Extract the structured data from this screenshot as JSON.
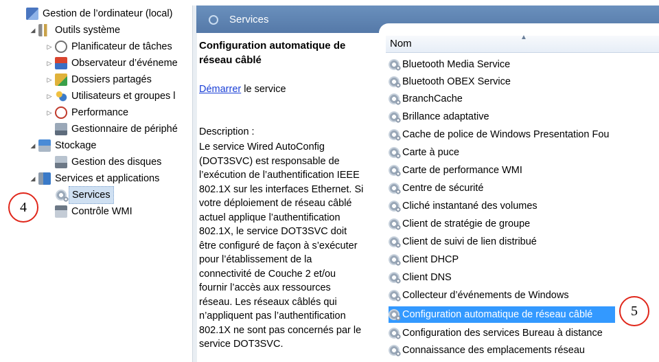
{
  "tree": {
    "root": {
      "label": "Gestion de l’ordinateur (local)",
      "icon": "computer-management-icon"
    },
    "items": [
      {
        "label": "Outils système",
        "icon": "system-tools-icon",
        "expanded": true
      },
      {
        "label": "Planificateur de tâches",
        "icon": "task-scheduler-icon"
      },
      {
        "label": "Observateur d’événeme",
        "icon": "event-viewer-icon"
      },
      {
        "label": "Dossiers partagés",
        "icon": "shared-folders-icon"
      },
      {
        "label": "Utilisateurs et groupes l",
        "icon": "users-groups-icon"
      },
      {
        "label": "Performance",
        "icon": "performance-icon"
      },
      {
        "label": "Gestionnaire de périphé",
        "icon": "device-manager-icon"
      },
      {
        "label": "Stockage",
        "icon": "storage-icon",
        "expanded": true
      },
      {
        "label": "Gestion des disques",
        "icon": "disk-management-icon"
      },
      {
        "label": "Services et applications",
        "icon": "services-apps-icon",
        "expanded": true
      },
      {
        "label": "Services",
        "icon": "services-gear-icon",
        "selected": true
      },
      {
        "label": "Contrôle WMI",
        "icon": "wmi-control-icon"
      }
    ]
  },
  "header": {
    "title": "Services",
    "icon": "services-icon"
  },
  "detail": {
    "title": "Configuration automatique de réseau câblé",
    "start_link": "Démarrer",
    "start_suffix": " le service",
    "description_label": "Description :",
    "description": "Le service Wired AutoConfig (DOT3SVC) est responsable de l’exécution de l’authentification IEEE 802.1X sur les interfaces Ethernet. Si votre déploiement de réseau câblé actuel applique l’authentification 802.1X, le service DOT3SVC doit être configuré de façon à s’exécuter pour l’établissement de la connectivité de Couche 2 et/ou fournir l’accès aux ressources réseau. Les réseaux câblés qui n’appliquent pas l’authentification 802.1X ne sont pas concernés par le service DOT3SVC."
  },
  "list": {
    "column_header": "Nom",
    "selected_index": 15,
    "rows": [
      "Bluetooth Media Service",
      "Bluetooth OBEX Service",
      "BranchCache",
      "Brillance adaptative",
      "Cache de police de Windows Presentation Fou",
      "Carte à puce",
      "Carte de performance WMI",
      "Centre de sécurité",
      "Cliché instantané des volumes",
      "Client de stratégie de groupe",
      "Client de suivi de lien distribué",
      "Client DHCP",
      "Client DNS",
      "Collecteur d’événements de Windows",
      "Configuration automatique de réseau câblé",
      "Configuration des services Bureau à distance",
      "Connaissance des emplacements réseau"
    ]
  },
  "callouts": {
    "left": "4",
    "right": "5"
  },
  "colors": {
    "selection": "#3399ff",
    "header": "#5f84b3",
    "callout_border": "#e0261a",
    "link": "#1a3fd6"
  }
}
